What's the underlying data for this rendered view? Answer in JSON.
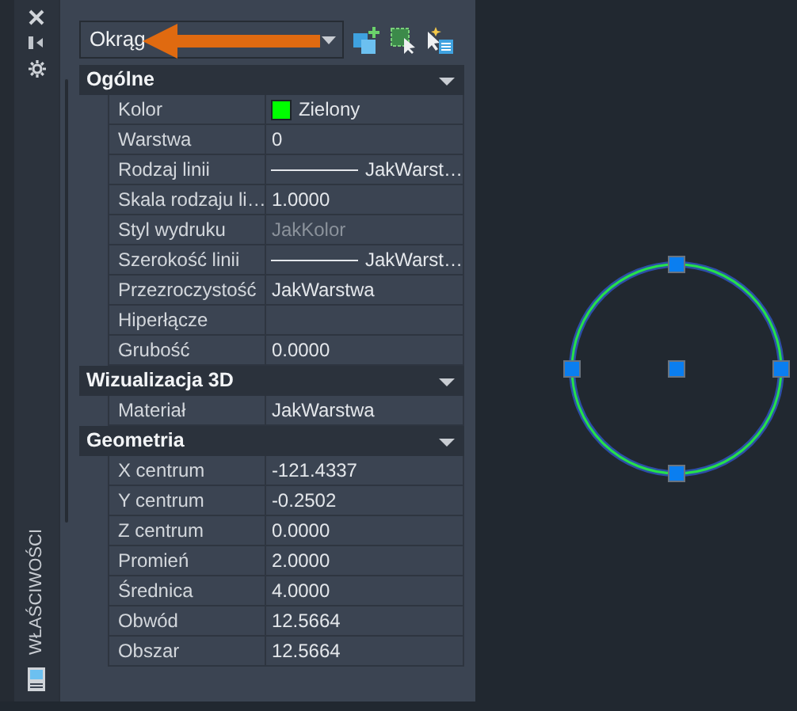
{
  "palette": {
    "title": "WŁAŚCIWOŚCI"
  },
  "selector": {
    "value": "Okrąg"
  },
  "sections": [
    {
      "title": "Ogólne",
      "expanded": true,
      "rows": [
        {
          "label": "Kolor",
          "value": "Zielony",
          "kind": "swatch",
          "color": "#00ff00",
          "disabled": false
        },
        {
          "label": "Warstwa",
          "value": "0",
          "kind": "plain",
          "disabled": false
        },
        {
          "label": "Rodzaj linii",
          "value": "JakWarst…",
          "kind": "line",
          "disabled": false
        },
        {
          "label": "Skala rodzaju li…",
          "value": "1.0000",
          "kind": "plain",
          "disabled": false
        },
        {
          "label": "Styl wydruku",
          "value": "JakKolor",
          "kind": "plain",
          "disabled": true
        },
        {
          "label": "Szerokość linii",
          "value": "JakWarst…",
          "kind": "line",
          "disabled": false
        },
        {
          "label": "Przezroczystość",
          "value": "JakWarstwa",
          "kind": "plain",
          "disabled": false
        },
        {
          "label": "Hiperłącze",
          "kind": "plain",
          "disabled": false
        },
        {
          "label": "Grubość",
          "value": "0.0000",
          "kind": "plain",
          "disabled": false
        }
      ]
    },
    {
      "title": "Wizualizacja 3D",
      "expanded": true,
      "rows": [
        {
          "label": "Materiał",
          "value": "JakWarstwa",
          "kind": "plain",
          "disabled": false
        }
      ]
    },
    {
      "title": "Geometria",
      "expanded": true,
      "rows": [
        {
          "label": "X centrum",
          "value": "-121.4337",
          "kind": "plain",
          "disabled": false
        },
        {
          "label": "Y centrum",
          "value": "-0.2502",
          "kind": "plain",
          "disabled": false
        },
        {
          "label": "Z centrum",
          "value": "0.0000",
          "kind": "plain",
          "disabled": false
        },
        {
          "label": "Promień",
          "value": "2.0000",
          "kind": "plain",
          "disabled": false
        },
        {
          "label": "Średnica",
          "value": "4.0000",
          "kind": "plain",
          "disabled": false
        },
        {
          "label": "Obwód",
          "value": "12.5664",
          "kind": "plain",
          "disabled": false
        },
        {
          "label": "Obszar",
          "value": "12.5664",
          "kind": "plain",
          "disabled": false
        }
      ]
    }
  ]
}
